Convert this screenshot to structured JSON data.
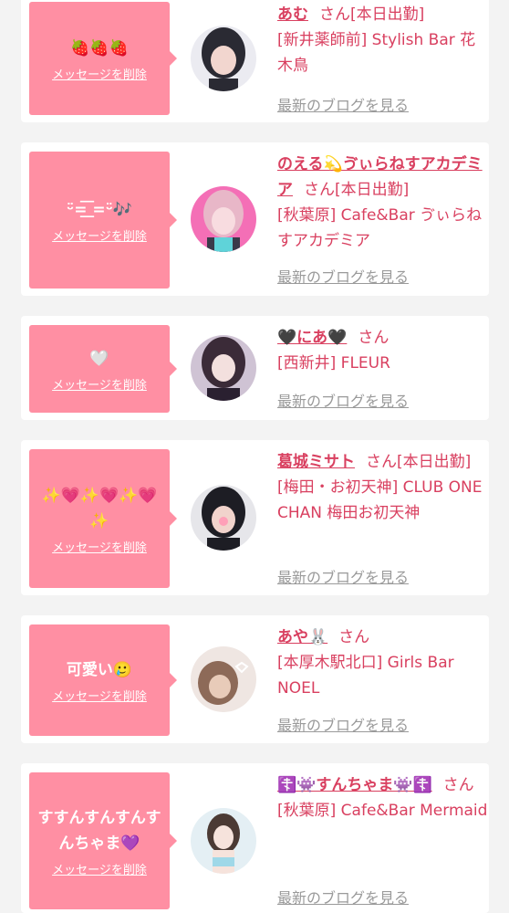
{
  "common": {
    "delete_label": "メッセージを削除",
    "blog_label": "最新のブログを見る",
    "san": "さん"
  },
  "cards": [
    {
      "message": "🍓🍓🍓",
      "name": "あむ",
      "status": "[本日出勤]",
      "area": "[新井薬師前]",
      "shop": "Stylish Bar 花木鳥",
      "avatar": {
        "skin": "#f2d6cf",
        "hair": "#2a2a33",
        "bg": "#ebebf1"
      }
    },
    {
      "message": "ᵕ̈=͟͟͞͞ =ᵕ̈🎶",
      "name": "のえる💫ゔぃらねすアカデミア",
      "status": "[本日出勤]",
      "area": "[秋葉原]",
      "shop": "Cafe&Bar ゔぃらねすアカデミア",
      "avatar": {
        "skin": "#f8dce0",
        "hair": "#e8b7c8",
        "bg": "#f46fb6"
      }
    },
    {
      "message": "🤍",
      "name": "🖤にあ🖤",
      "status": "",
      "area": "[西新井]",
      "shop": "FLEUR",
      "avatar": {
        "skin": "#f3e0de",
        "hair": "#3b2b38",
        "bg": "#cfc3d4"
      }
    },
    {
      "message": "✨💗✨💗✨💗✨",
      "name": "葛城ミサト",
      "status": "[本日出勤]",
      "area": "[梅田・お初天神]",
      "shop": "CLUB ONE CHAN 梅田お初天神",
      "avatar": {
        "skin": "#f1d3cc",
        "hair": "#1d1d24",
        "bg": "#e6e6ea"
      }
    },
    {
      "message": "可愛い🥲",
      "name": "あや🐰",
      "status": "",
      "area": "[本厚木駅北口]",
      "shop": "Girls Bar NOEL",
      "avatar": {
        "skin": "#e8cbb9",
        "hair": "#8d6a58",
        "bg": "#efe6e2"
      }
    },
    {
      "message": "すすんすんすんすんちゃま💜",
      "name": "☦️👾すんちゃま👾☦️",
      "status": "",
      "area": "[秋葉原]",
      "shop": "Cafe&Bar Mermaid",
      "avatar": {
        "skin": "#f6e3dc",
        "hair": "#4b3a34",
        "bg": "#e4eff4"
      }
    }
  ]
}
